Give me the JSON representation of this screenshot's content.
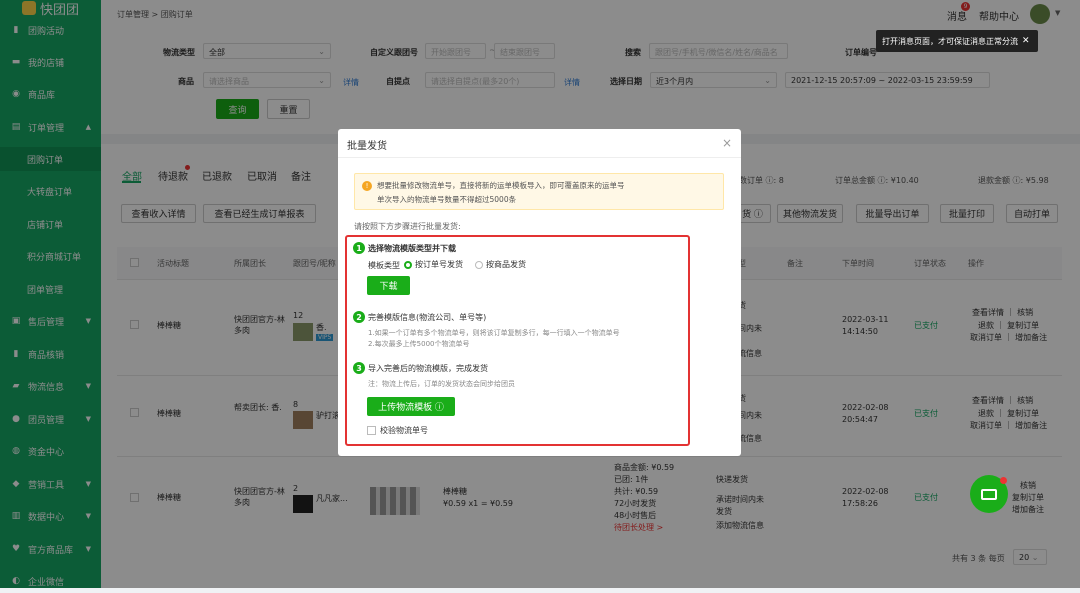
{
  "sidebar": {
    "logo": "快团团",
    "items": [
      {
        "label": "团购活动",
        "icon": "bookmark-icon"
      },
      {
        "label": "我的店铺",
        "icon": "store-icon"
      },
      {
        "label": "商品库",
        "icon": "box-icon"
      },
      {
        "label": "订单管理",
        "icon": "order-icon",
        "arrow": "^"
      },
      {
        "label": "团购订单"
      },
      {
        "label": "大转盘订单"
      },
      {
        "label": "店铺订单"
      },
      {
        "label": "积分商城订单"
      },
      {
        "label": "团单管理"
      },
      {
        "label": "售后管理",
        "icon": "aftersale-icon",
        "arrow": "v"
      },
      {
        "label": "商品核销",
        "icon": "verify-icon"
      },
      {
        "label": "物流信息",
        "icon": "truck-icon",
        "arrow": "v"
      },
      {
        "label": "团员管理",
        "icon": "user-icon",
        "arrow": "v"
      },
      {
        "label": "资金中心",
        "icon": "money-icon"
      },
      {
        "label": "营销工具",
        "icon": "tag-icon",
        "arrow": "v"
      },
      {
        "label": "数据中心",
        "icon": "chart-icon",
        "arrow": "v"
      },
      {
        "label": "官方商品库",
        "icon": "heart-icon",
        "arrow": "v"
      },
      {
        "label": "企业微信",
        "icon": "wechat-icon"
      }
    ]
  },
  "breadcrumb": {
    "root": "订单管理",
    "sep": ">",
    "current": "团购订单"
  },
  "topbar": {
    "messages": "消息",
    "msg_badge": "9",
    "help": "帮助中心"
  },
  "tooltip": {
    "text": "打开消息页面，才可保证消息正常分流",
    "close": "✕"
  },
  "filters": {
    "logistics_type_label": "物流类型",
    "logistics_type_value": "全部",
    "custom_id_label": "自定义跟团号",
    "start_placeholder": "开始跟团号",
    "end_placeholder": "结束跟团号",
    "search_label": "搜索",
    "search_placeholder": "跟团号/手机号/微信名/姓名/商品名",
    "order_no_label": "订单编号",
    "product_label": "商品",
    "product_placeholder": "请选择商品",
    "detail_link": "详情",
    "pickup_label": "自提点",
    "pickup_placeholder": "请选择自提点(最多20个)",
    "date_label": "选择日期",
    "date_value": "近3个月内",
    "date_range": "2021-12-15 20:57:09 ~ 2022-03-15 23:59:59",
    "query_btn": "查询",
    "reset_btn": "重置"
  },
  "tabs": [
    "全部",
    "待退款",
    "已退款",
    "已取消",
    "备注"
  ],
  "summary": {
    "orders": "数订单 ⓘ: 8",
    "total": "订单总金额 ⓘ: ¥10.40",
    "refund": "退款金额 ⓘ: ¥5.98"
  },
  "actions_left": [
    "查看收入详情",
    "查看已经生成订单报表"
  ],
  "actions_right": [
    "货 ⓘ",
    "其他物流发货",
    "批量导出订单",
    "批量打印",
    "自动打单"
  ],
  "table_headers": [
    "活动标题",
    "所属团长",
    "跟团号/昵称",
    "型",
    "备注",
    "下单时间",
    "订单状态",
    "操作"
  ],
  "rows": [
    {
      "title": "棒棒糖",
      "leader": "快团团官方-林多肉",
      "num": "12",
      "nick": "香.",
      "badge": "VIP5",
      "ship1": "货",
      "ship2": "间内未",
      "ship3": "流信息",
      "time1": "2022-03-11",
      "time2": "14:14:50",
      "status": "已支付",
      "ops1": "查看详情 ｜ 核销",
      "ops2": "退款 ｜ 复制订单",
      "ops3": "取消订单 ｜ 增加备注"
    },
    {
      "title": "棒棒糖",
      "leader": "帮卖团长: 香.",
      "num": "8",
      "nick": "驴打滚",
      "ship1": "货",
      "ship2": "间内未",
      "ship3": "流信息",
      "time1": "2022-02-08",
      "time2": "20:54:47",
      "status": "已支付",
      "ops1": "查看详情 ｜ 核销",
      "ops2": "退款 ｜ 复制订单",
      "ops3": "取消订单 ｜ 增加备注"
    },
    {
      "title": "棒棒糖",
      "leader": "快团团官方-林多肉",
      "num": "2",
      "nick": "凡凡家...",
      "prod": "棒棒糖",
      "price": "¥0.59 x1 = ¥0.59",
      "amt1": "商品金额: ¥0.59",
      "amt2": "已团: 1件",
      "amt3": "共计: ¥0.59",
      "amt4": "72小时发货",
      "amt5": "48小时售后",
      "amt6": "待团长处理 >",
      "ship1": "快递发货",
      "ship2": "承诺时间内未",
      "ship3": "发货",
      "ship4": "添加物流信息",
      "time1": "2022-02-08",
      "time2": "17:58:26",
      "status": "已支付",
      "ops1": "核销",
      "ops2": "复制订单",
      "ops3": "增加备注"
    }
  ],
  "pagination": {
    "total": "共有 3 条 每页",
    "size": "20"
  },
  "modal": {
    "title": "批量发货",
    "close": "×",
    "notice1": "想要批量修改物流单号，直接将新的运单模板导入，即可覆盖原来的运单号",
    "notice2": "单次导入的物流单号数量不得超过5000条",
    "instruction": "请按照下方步骤进行批量发货:",
    "step1_num": "1",
    "step1_title": "选择物流模版类型并下载",
    "template_label": "模板类型",
    "opt1": "按订单号发货",
    "opt2": "按商品发货",
    "download_btn": "下载",
    "step2_num": "2",
    "step2_title": "完善模版信息(物流公司、单号等)",
    "step2_line1": "1.如果一个订单有多个物流单号，则将该订单复制多行，每一行填入一个物流单号",
    "step2_line2": "2.每次最多上传5000个物流单号",
    "step3_num": "3",
    "step3_title": "导入完善后的物流模版，完成发货",
    "step3_note": "注：物流上传后，订单的发货状态会同步给团员",
    "upload_btn": "上传物流模板 ⓘ",
    "verify_label": "校验物流单号"
  },
  "colors": {
    "brand": "#17a865",
    "button": "#1aad19",
    "highlight": "#e33333"
  }
}
